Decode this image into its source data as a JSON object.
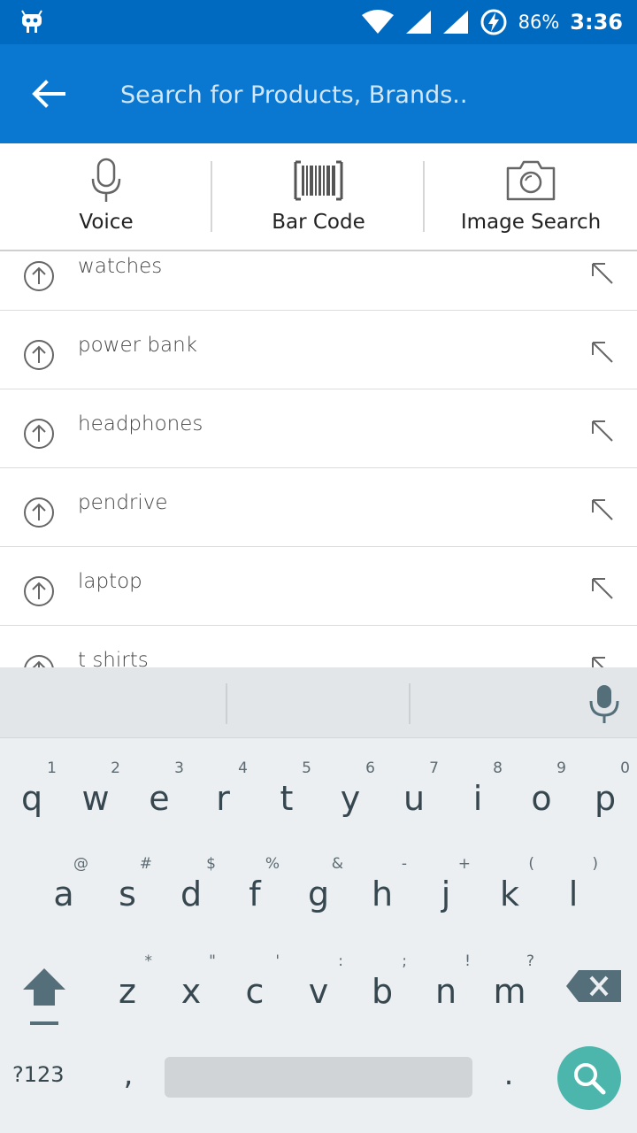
{
  "status_bar": {
    "battery": "86%",
    "time": "3:36",
    "icons": [
      "cyanogen-bugdroid-icon",
      "wifi-icon",
      "cell-signal-icon",
      "cell-signal-icon",
      "battery-charging-icon"
    ]
  },
  "search": {
    "placeholder": "Search for Products, Brands..",
    "value": ""
  },
  "options": [
    {
      "label": "Voice",
      "icon": "microphone-icon"
    },
    {
      "label": "Bar Code",
      "icon": "barcode-icon"
    },
    {
      "label": "Image Search",
      "icon": "camera-icon"
    }
  ],
  "suggestions": [
    {
      "text": "watches"
    },
    {
      "text": "power bank"
    },
    {
      "text": "headphones"
    },
    {
      "text": "pendrive"
    },
    {
      "text": "laptop"
    },
    {
      "text": "t shirts"
    }
  ],
  "keyboard": {
    "row1": [
      {
        "key": "q",
        "hint": "1"
      },
      {
        "key": "w",
        "hint": "2"
      },
      {
        "key": "e",
        "hint": "3"
      },
      {
        "key": "r",
        "hint": "4"
      },
      {
        "key": "t",
        "hint": "5"
      },
      {
        "key": "y",
        "hint": "6"
      },
      {
        "key": "u",
        "hint": "7"
      },
      {
        "key": "i",
        "hint": "8"
      },
      {
        "key": "o",
        "hint": "9"
      },
      {
        "key": "p",
        "hint": "0"
      }
    ],
    "row2": [
      {
        "key": "a",
        "hint": "@"
      },
      {
        "key": "s",
        "hint": "#"
      },
      {
        "key": "d",
        "hint": "$"
      },
      {
        "key": "f",
        "hint": "%"
      },
      {
        "key": "g",
        "hint": "&"
      },
      {
        "key": "h",
        "hint": "-"
      },
      {
        "key": "j",
        "hint": "+"
      },
      {
        "key": "k",
        "hint": "("
      },
      {
        "key": "l",
        "hint": ")"
      }
    ],
    "row3": [
      {
        "key": "z",
        "hint": "*"
      },
      {
        "key": "x",
        "hint": "\""
      },
      {
        "key": "c",
        "hint": "'"
      },
      {
        "key": "v",
        "hint": ":"
      },
      {
        "key": "b",
        "hint": ";"
      },
      {
        "key": "n",
        "hint": "!"
      },
      {
        "key": "m",
        "hint": "?"
      }
    ],
    "symbols_label": "?123",
    "comma": ",",
    "period": "."
  },
  "colors": {
    "status_bar": "#0069c0",
    "app_bar": "#0a78d1",
    "search_key": "#4db6ac"
  }
}
